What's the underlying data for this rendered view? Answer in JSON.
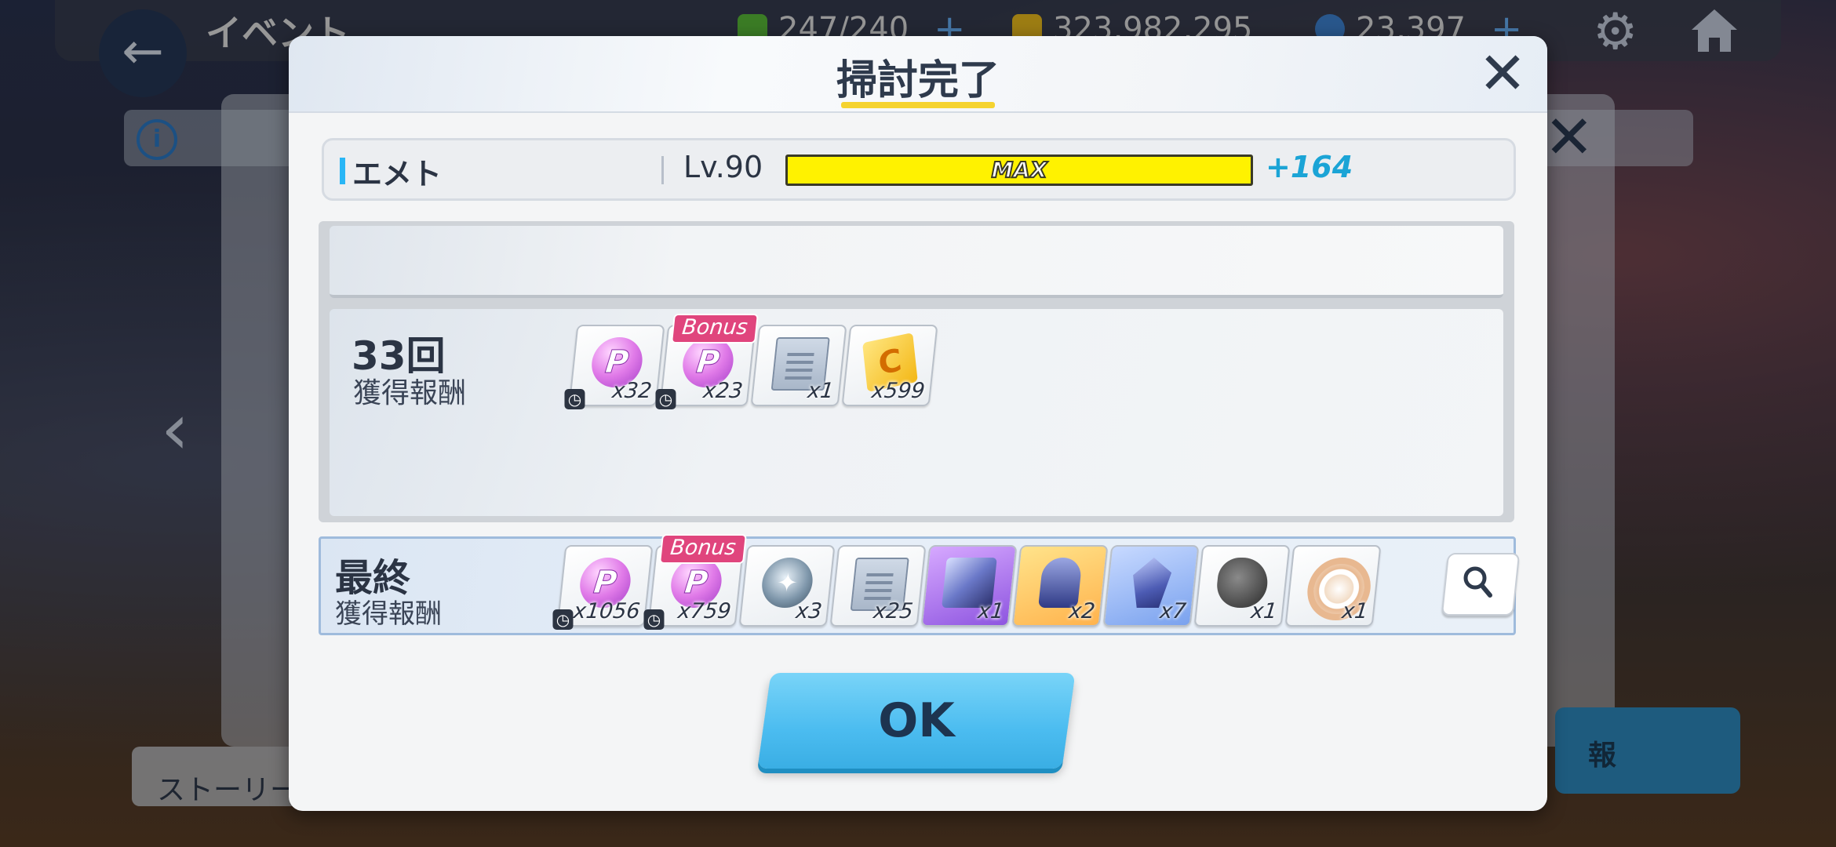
{
  "background": {
    "screen_title": "イベント",
    "resources": [
      {
        "name": "stamina",
        "value": "247/240",
        "color": "#5bbf3a"
      },
      {
        "name": "mana",
        "value": "323,982,295",
        "color": "#f2c01e"
      },
      {
        "name": "gems",
        "value": "23,397",
        "color": "#3f86d8"
      }
    ],
    "story_label": "ストーリー",
    "right_button_label": "報"
  },
  "dialog": {
    "title": "掃討完了",
    "character": {
      "name": "エメト",
      "level": "Lv.90",
      "exp_label": "MAX",
      "exp_fraction": 1.0,
      "exp_gain": "+164"
    },
    "runs": {
      "count_label": "33回",
      "sub_label": "獲得報酬",
      "items": [
        {
          "icon": "princess-orb-icon",
          "qty": "x32",
          "bonus": "",
          "timer": true
        },
        {
          "icon": "princess-orb-icon",
          "qty": "x23",
          "bonus": "Bonus",
          "timer": true
        },
        {
          "icon": "report-icon",
          "qty": "x1",
          "bonus": "",
          "timer": false
        },
        {
          "icon": "mana-card-icon",
          "qty": "x599",
          "bonus": "",
          "timer": false
        }
      ]
    },
    "final": {
      "title": "最終",
      "sub_label": "獲得報酬",
      "items": [
        {
          "icon": "princess-orb-icon",
          "qty": "x1056",
          "bonus": "",
          "timer": true
        },
        {
          "icon": "princess-orb-icon",
          "qty": "x759",
          "bonus": "Bonus",
          "timer": true
        },
        {
          "icon": "silver-orb-icon",
          "qty": "x3",
          "bonus": "",
          "timer": false
        },
        {
          "icon": "report-icon",
          "qty": "x25",
          "bonus": "",
          "timer": false
        },
        {
          "icon": "cube-icon",
          "qty": "x1",
          "bonus": "",
          "timer": false
        },
        {
          "icon": "capsule-icon",
          "qty": "x2",
          "bonus": "",
          "timer": false
        },
        {
          "icon": "crystal-icon",
          "qty": "x7",
          "bonus": "",
          "timer": false
        },
        {
          "icon": "rock-icon",
          "qty": "x1",
          "bonus": "",
          "timer": false
        },
        {
          "icon": "ring-icon",
          "qty": "x1",
          "bonus": "",
          "timer": false
        }
      ]
    },
    "ok_label": "OK"
  }
}
